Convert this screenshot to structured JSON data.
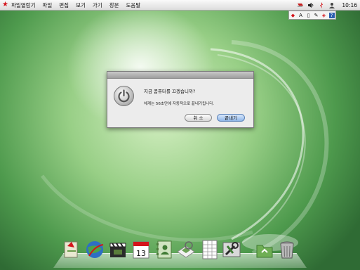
{
  "menubar": {
    "items": [
      "파일열람기",
      "파일",
      "편집",
      "보기",
      "가기",
      "창문",
      "도움말"
    ],
    "clock": "10:16"
  },
  "ime": {
    "letter": "A"
  },
  "dialog": {
    "question": "지금 콤퓨터를 끄겠습니까?",
    "detail": "체계는 56초만에 자동적으로 끝내기됩니다.",
    "cancel_label": "취 소",
    "ok_label": "끝내기"
  },
  "dock": {
    "calendar_day": "13"
  },
  "colors": {
    "accent_red": "#d4141b",
    "desktop_green": "#7fbf6e"
  }
}
